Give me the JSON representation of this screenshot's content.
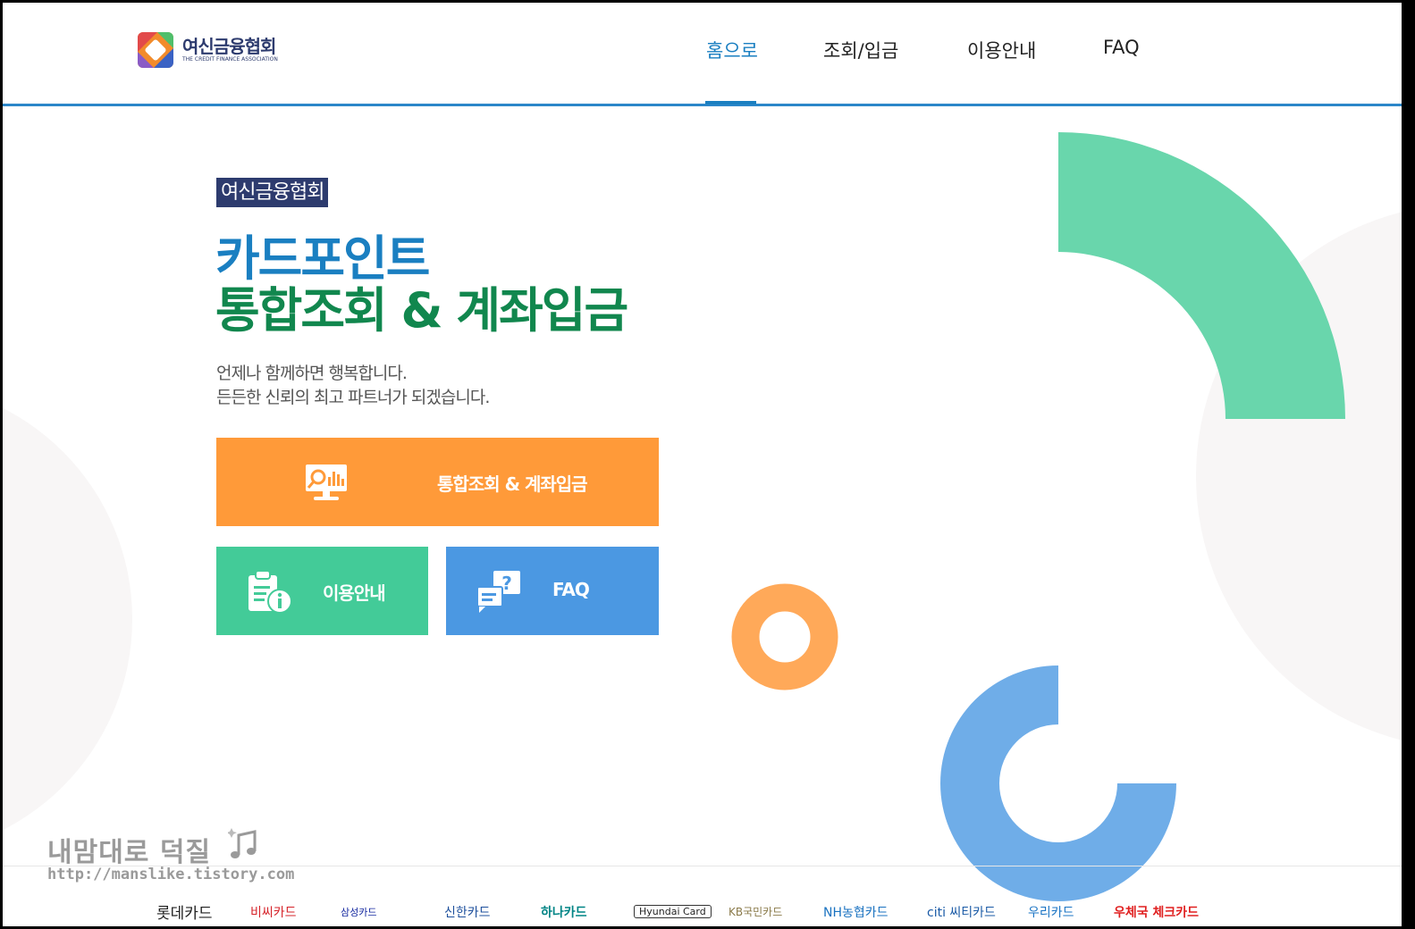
{
  "header": {
    "logo_ko": "여신금융협회",
    "logo_en": "THE CREDIT FINANCE ASSOCIATION",
    "nav": [
      {
        "label": "홈으로",
        "active": true
      },
      {
        "label": "조회/입금",
        "active": false
      },
      {
        "label": "이용안내",
        "active": false
      },
      {
        "label": "FAQ",
        "active": false
      }
    ]
  },
  "hero": {
    "badge": "여신금융협회",
    "title_line1": "카드포인트",
    "title_line2": "통합조회 & 계좌입금",
    "desc_line1": "언제나 함께하면 행복합니다.",
    "desc_line2": "든든한 신뢰의 최고 파트너가 되겠습니다."
  },
  "tiles": {
    "main": {
      "label": "통합조회 & 계좌입금",
      "color": "#ff9a39",
      "icon": "presentation-search-icon"
    },
    "guide": {
      "label": "이용안내",
      "color": "#43cb98",
      "icon": "clipboard-info-icon"
    },
    "faq": {
      "label": "FAQ",
      "color": "#4b98e2",
      "icon": "chat-question-icon"
    }
  },
  "watermark": {
    "line1": "내맘대로 덕질",
    "line2": "http://manslike.tistory.com"
  },
  "partners": [
    {
      "label": "롯데카드",
      "color": "#222222"
    },
    {
      "label": "비씨카드",
      "color": "#d6232a"
    },
    {
      "label": "삼성카드",
      "color": "#1428a0"
    },
    {
      "label": "신한카드",
      "color": "#1d4f9c"
    },
    {
      "label": "하나카드",
      "color": "#008485"
    },
    {
      "label": "Hyundai Card",
      "color": "#222222"
    },
    {
      "label": "KB국민카드",
      "color": "#8a7a4a"
    },
    {
      "label": "NH농협카드",
      "color": "#1a72c0"
    },
    {
      "label": "citi 씨티카드",
      "color": "#1a5aa6"
    },
    {
      "label": "우리카드",
      "color": "#1b74c4"
    },
    {
      "label": "우체국 체크카드",
      "color": "#e02020"
    }
  ],
  "colors": {
    "accent_blue": "#1a7fc1",
    "accent_green": "#11874e",
    "navy": "#2d3b6e"
  }
}
